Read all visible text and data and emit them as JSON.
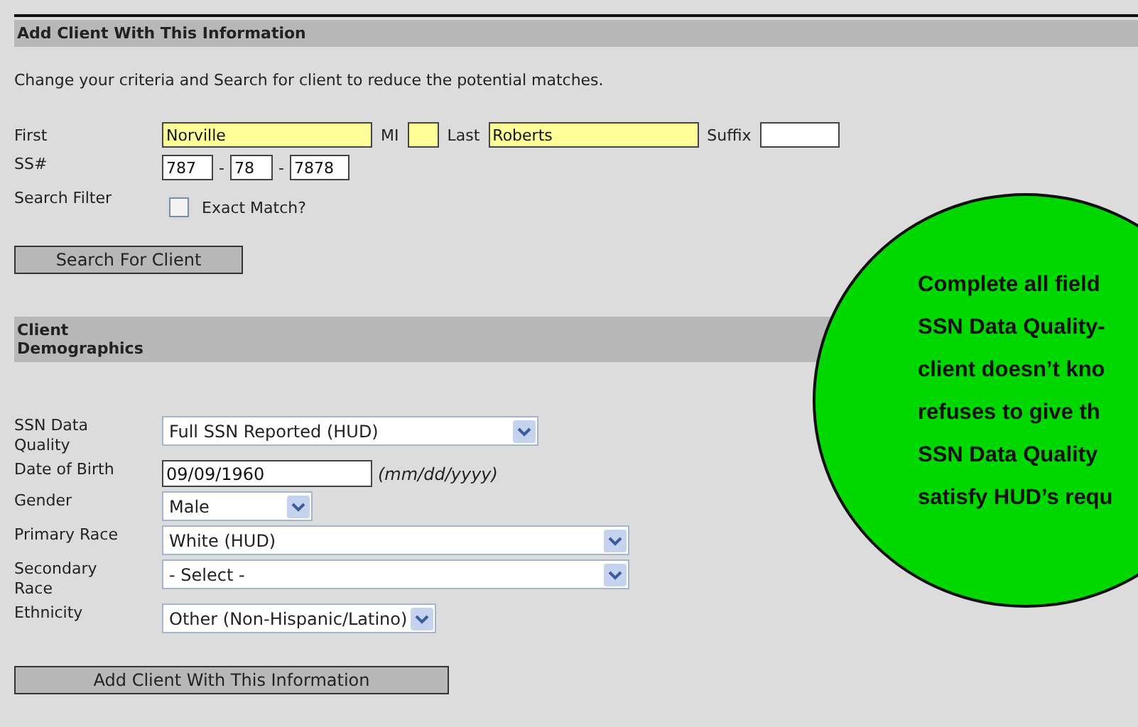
{
  "header": {
    "title": "Add Client With This Information"
  },
  "instructions": "Change your criteria and Search for client to reduce the potential matches.",
  "name_fields": [
    {
      "label": "First",
      "value": "Norville",
      "kind": "long"
    },
    {
      "label": "MI",
      "kind": "short"
    },
    {
      "label": "Last",
      "value": "Roberts",
      "kind": "long"
    },
    {
      "label": "Suffix",
      "kind": "plain"
    }
  ],
  "ssn": {
    "label": "SS#",
    "parts": [
      "787",
      "78",
      "7878"
    ],
    "separator": "-"
  },
  "search_filter": {
    "label": "Search Filter",
    "option": "Exact Match?",
    "checked": false
  },
  "search_button": "Search For Client",
  "demographics": {
    "title": "Client Demographics",
    "fields": [
      {
        "label": "SSN Data Quality",
        "kind": "select",
        "value": "Full SSN Reported (HUD)"
      },
      {
        "label": "Date of Birth",
        "kind": "date",
        "value": "09/09/1960",
        "hint": "(mm/dd/yyyy)"
      },
      {
        "label": "Gender",
        "kind": "select",
        "value": "Male"
      },
      {
        "label": "Primary Race",
        "kind": "select",
        "value": "White (HUD)"
      },
      {
        "label": "Secondary Race",
        "kind": "select",
        "value": "- Select -"
      },
      {
        "label": "Ethnicity",
        "kind": "select",
        "value": "Other (Non-Hispanic/Latino)"
      }
    ]
  },
  "add_button": "Add Client With This Information",
  "callout": {
    "lines": [
      "Complete all field",
      "SSN Data Quality-",
      "client doesn’t kno",
      "refuses to give th",
      "SSN Data Quality",
      "satisfy HUD’s requ"
    ]
  }
}
